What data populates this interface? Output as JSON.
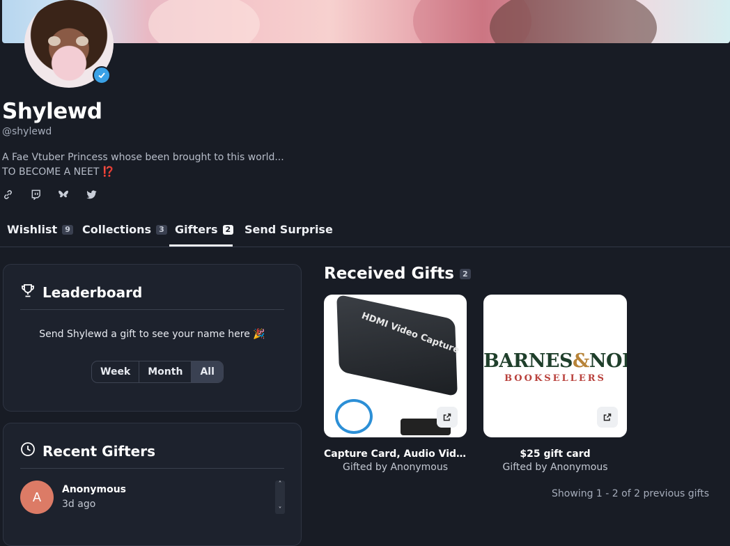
{
  "profile": {
    "name": "Shylewd",
    "handle": "@shylewd",
    "bio_line1": "A Fae Vtuber Princess whose been brought to this world...",
    "bio_line2": "TO BECOME A NEET",
    "bio_emoji": "⁉️"
  },
  "socials": [
    "link-icon",
    "twitch-icon",
    "bluesky-icon",
    "twitter-icon"
  ],
  "tabs": [
    {
      "label": "Wishlist",
      "count": "9"
    },
    {
      "label": "Collections",
      "count": "3"
    },
    {
      "label": "Gifters",
      "count": "2",
      "active": true
    },
    {
      "label": "Send Surprise"
    }
  ],
  "leaderboard": {
    "title": "Leaderboard",
    "message": "Send Shylewd a gift to see your name here 🎉",
    "periods": [
      "Week",
      "Month",
      "All"
    ],
    "selected": "All"
  },
  "recent_gifters": {
    "title": "Recent Gifters",
    "items": [
      {
        "initial": "A",
        "name": "Anonymous",
        "time": "3d ago"
      }
    ]
  },
  "received": {
    "title": "Received Gifts",
    "count": "2",
    "gifts": [
      {
        "name": "Capture Card, Audio Video...",
        "by": "Gifted by Anonymous",
        "image_text": "HDMI Video Capture"
      },
      {
        "name": "$25 gift card",
        "by": "Gifted by Anonymous",
        "brand_main_left": "BARNES",
        "brand_amp": "&",
        "brand_main_right": "NOBLE",
        "brand_sub": "BOOKSELLERS"
      }
    ],
    "showing": "Showing 1 - 2 of 2 previous gifts"
  },
  "colors": {
    "background": "#181c25",
    "card": "#1d222d",
    "avatar_initial_bg": "#dc7b66",
    "verified": "#3aa1e6"
  }
}
